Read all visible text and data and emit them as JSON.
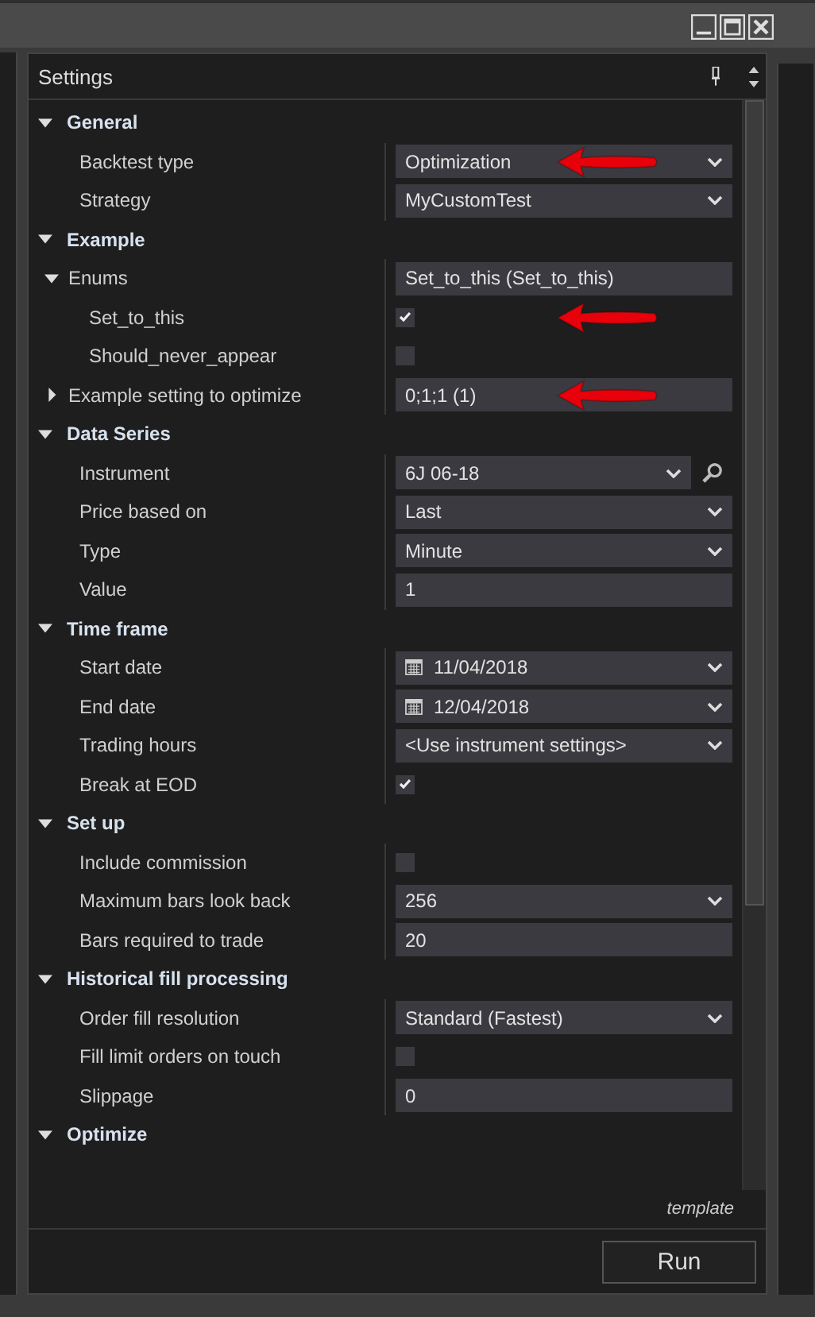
{
  "panel": {
    "title": "Settings"
  },
  "sections": [
    {
      "title": "General",
      "expanded": true,
      "rows": [
        {
          "label": "Backtest type",
          "kind": "dropdown",
          "value": "Optimization",
          "arrow": true
        },
        {
          "label": "Strategy",
          "kind": "dropdown",
          "value": "MyCustomTest"
        }
      ]
    },
    {
      "title": "Example",
      "expanded": true,
      "rows": [
        {
          "label": "Enums",
          "kind": "group",
          "value": "Set_to_this (Set_to_this)",
          "expanded": true,
          "children": [
            {
              "label": "Set_to_this",
              "kind": "checkbox",
              "checked": true,
              "arrow": true
            },
            {
              "label": "Should_never_appear",
              "kind": "checkbox",
              "checked": false
            }
          ]
        },
        {
          "label": "Example setting to optimize",
          "kind": "group",
          "value": "0;1;1 (1)",
          "expanded": false,
          "arrow": true
        }
      ]
    },
    {
      "title": "Data Series",
      "expanded": true,
      "rows": [
        {
          "label": "Instrument",
          "kind": "instrument",
          "value": "6J 06-18"
        },
        {
          "label": "Price based on",
          "kind": "dropdown",
          "value": "Last"
        },
        {
          "label": "Type",
          "kind": "dropdown",
          "value": "Minute"
        },
        {
          "label": "Value",
          "kind": "text",
          "value": "1"
        }
      ]
    },
    {
      "title": "Time frame",
      "expanded": true,
      "rows": [
        {
          "label": "Start date",
          "kind": "date",
          "value": "11/04/2018"
        },
        {
          "label": "End date",
          "kind": "date",
          "value": "12/04/2018"
        },
        {
          "label": "Trading hours",
          "kind": "dropdown",
          "value": "<Use instrument settings>"
        },
        {
          "label": "Break at EOD",
          "kind": "checkbox",
          "checked": true
        }
      ]
    },
    {
      "title": "Set up",
      "expanded": true,
      "rows": [
        {
          "label": "Include commission",
          "kind": "checkbox",
          "checked": false
        },
        {
          "label": "Maximum bars look back",
          "kind": "dropdown",
          "value": "256"
        },
        {
          "label": "Bars required to trade",
          "kind": "text",
          "value": "20"
        }
      ]
    },
    {
      "title": "Historical fill processing",
      "expanded": true,
      "rows": [
        {
          "label": "Order fill resolution",
          "kind": "dropdown",
          "value": "Standard (Fastest)"
        },
        {
          "label": "Fill limit orders on touch",
          "kind": "checkbox",
          "checked": false
        },
        {
          "label": "Slippage",
          "kind": "text",
          "value": "0"
        }
      ]
    },
    {
      "title": "Optimize",
      "expanded": true
    }
  ],
  "template_label": "template",
  "run_button": "Run"
}
